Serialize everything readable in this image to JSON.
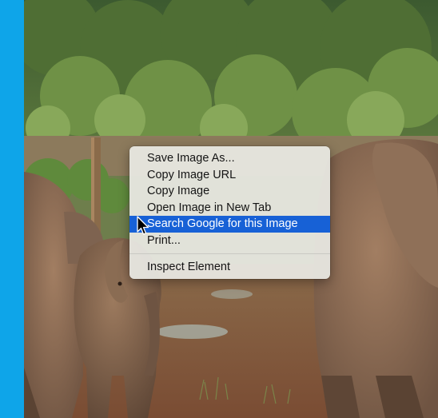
{
  "context_menu": {
    "items": [
      {
        "label": "Save Image As..."
      },
      {
        "label": "Copy Image URL"
      },
      {
        "label": "Copy Image"
      },
      {
        "label": "Open Image in New Tab"
      },
      {
        "label": "Search Google for this Image",
        "highlighted": true
      },
      {
        "label": "Print..."
      },
      {
        "label": "Inspect Element"
      }
    ]
  },
  "colors": {
    "accent_strip": "#0ea5e9",
    "menu_highlight": "#1761d6"
  },
  "icons": {
    "cursor": "mouse-pointer-icon"
  }
}
